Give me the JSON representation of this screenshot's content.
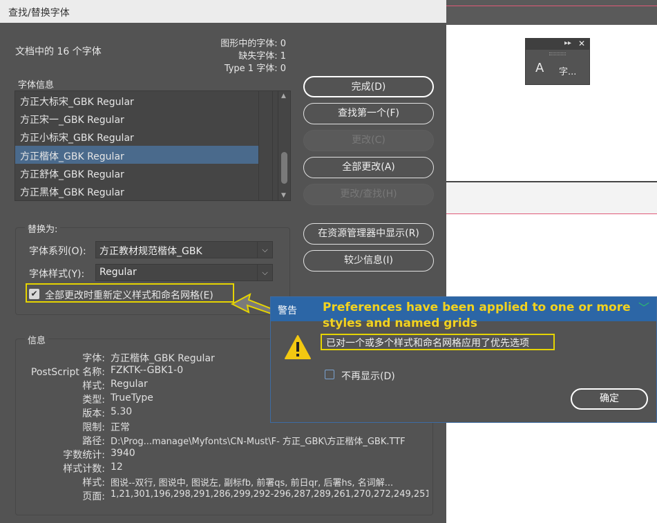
{
  "dialog": {
    "title": "查找/替换字体",
    "fonts_in_document": "文档中的 16 个字体",
    "stats": {
      "graphics_fonts": "图形中的字体: 0",
      "missing_fonts": "缺失字体: 1",
      "type1_fonts": "Type 1 字体: 0"
    },
    "font_info_legend": "字体信息",
    "font_list": [
      "方正大标宋_GBK Regular",
      "方正宋一_GBK Regular",
      "方正小标宋_GBK Regular",
      "方正楷体_GBK Regular",
      "方正舒体_GBK Regular",
      "方正黑体_GBK Regular"
    ],
    "selected_index": 3,
    "buttons": {
      "done": "完成(D)",
      "find_first": "查找第一个(F)",
      "change": "更改(C)",
      "change_all": "全部更改(A)",
      "change_find": "更改/查找(H)",
      "reveal_in_explorer": "在资源管理器中显示(R)",
      "fewer_info": "较少信息(I)"
    },
    "replace": {
      "legend": "替换为:",
      "family_label": "字体系列(O):",
      "family_value": "方正教材规范楷体_GBK",
      "style_label": "字体样式(Y):",
      "style_value": "Regular",
      "redefine_checkbox_label": "全部更改时重新定义样式和命名网格(E)",
      "redefine_checked": true
    },
    "info": {
      "legend": "信息",
      "rows": [
        {
          "key": "字体:",
          "value": "方正楷体_GBK Regular"
        },
        {
          "key": "PostScript 名称:",
          "value": "FZKTK--GBK1-0"
        },
        {
          "key": "样式:",
          "value": "Regular"
        },
        {
          "key": "类型:",
          "value": "TrueType"
        },
        {
          "key": "版本:",
          "value": "5.30"
        },
        {
          "key": "限制:",
          "value": "正常"
        },
        {
          "key": "路径:",
          "value": "D:\\Prog...manage\\Myfonts\\CN-Must\\F- 方正_GBK\\方正楷体_GBK.TTF"
        },
        {
          "key": "字数统计:",
          "value": "3940"
        },
        {
          "key": "样式计数:",
          "value": "12"
        },
        {
          "key": "样式:",
          "value": "图说--双行, 图说中, 图说左, 副标fb, 前署qs, 前日qr, 后署hs, 名词解..."
        },
        {
          "key": "页面:",
          "value": "1,21,301,196,298,291,286,299,292-296,287,289,261,270,272,249,251-2"
        }
      ]
    }
  },
  "alert": {
    "title": "警告",
    "annotation_en": "Preferences have been applied to one or more styles and named grids",
    "message": "已对一个或多个样式和命名网格应用了优先选项",
    "dont_show_label": "不再显示(D)",
    "dont_show_checked": false,
    "ok_label": "确定"
  },
  "float_panel": {
    "label": "字...",
    "glyph": "A"
  },
  "colors": {
    "dialog_bg": "#535353",
    "selection": "#4a6a8c",
    "alert_title": "#2c66a6",
    "annotation": "#f2d21f"
  }
}
